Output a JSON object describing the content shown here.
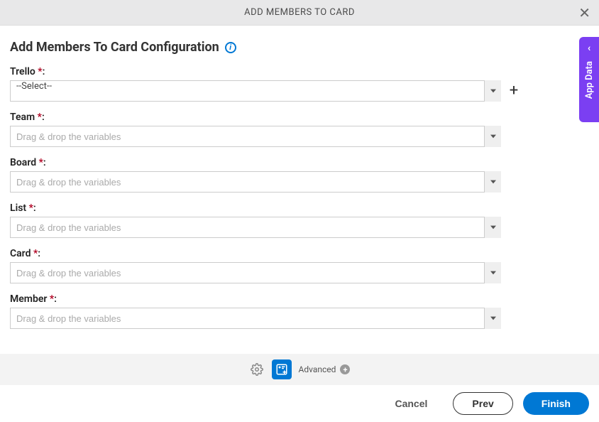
{
  "header": {
    "title": "ADD MEMBERS TO CARD"
  },
  "page": {
    "title": "Add Members To Card Configuration"
  },
  "fields": {
    "trello": {
      "label": "Trello",
      "required": "*",
      "colon": ":",
      "value": "--Select--",
      "placeholder": ""
    },
    "team": {
      "label": "Team",
      "required": "*",
      "colon": ":",
      "placeholder": "Drag & drop the variables"
    },
    "board": {
      "label": "Board",
      "required": "*",
      "colon": ":",
      "placeholder": "Drag & drop the variables"
    },
    "list": {
      "label": "List",
      "required": "*",
      "colon": ":",
      "placeholder": "Drag & drop the variables"
    },
    "card": {
      "label": "Card",
      "required": "*",
      "colon": ":",
      "placeholder": "Drag & drop the variables"
    },
    "member": {
      "label": "Member",
      "required": "*",
      "colon": ":",
      "placeholder": "Drag & drop the variables"
    }
  },
  "toolbar": {
    "advanced": "Advanced"
  },
  "footer": {
    "cancel": "Cancel",
    "prev": "Prev",
    "finish": "Finish"
  },
  "sidetab": {
    "label": "App Data"
  }
}
